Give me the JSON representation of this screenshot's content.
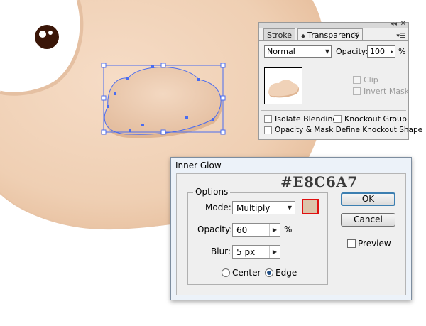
{
  "transparency_panel": {
    "tabs": [
      {
        "label": "Stroke",
        "active": false
      },
      {
        "label": "Transparency",
        "active": true
      }
    ],
    "blend_mode": "Normal",
    "opacity_label": "Opacity:",
    "opacity_value": "100",
    "opacity_unit": "%",
    "clip_label": "Clip",
    "invert_mask_label": "Invert Mask",
    "isolate_blending_label": "Isolate Blending",
    "knockout_group_label": "Knockout Group",
    "opacity_mask_label": "Opacity & Mask Define Knockout Shape"
  },
  "annotation": {
    "hex_color": "#E8C6A7"
  },
  "inner_glow_dialog": {
    "title": "Inner Glow",
    "options_label": "Options",
    "mode_label": "Mode:",
    "mode_value": "Multiply",
    "opacity_label": "Opacity:",
    "opacity_value": "60",
    "opacity_unit": "%",
    "blur_label": "Blur:",
    "blur_value": "5 px",
    "center_label": "Center",
    "edge_label": "Edge",
    "selected_source": "Edge",
    "ok_label": "OK",
    "cancel_label": "Cancel",
    "preview_label": "Preview",
    "preview_checked": false,
    "swatch_color": "#DCC4AA"
  },
  "colors": {
    "skin": "#F0D3BA",
    "skin_shadow": "#E3BE9F",
    "selection": "#4A6CF0",
    "eye_pupil": "#3A1608"
  }
}
